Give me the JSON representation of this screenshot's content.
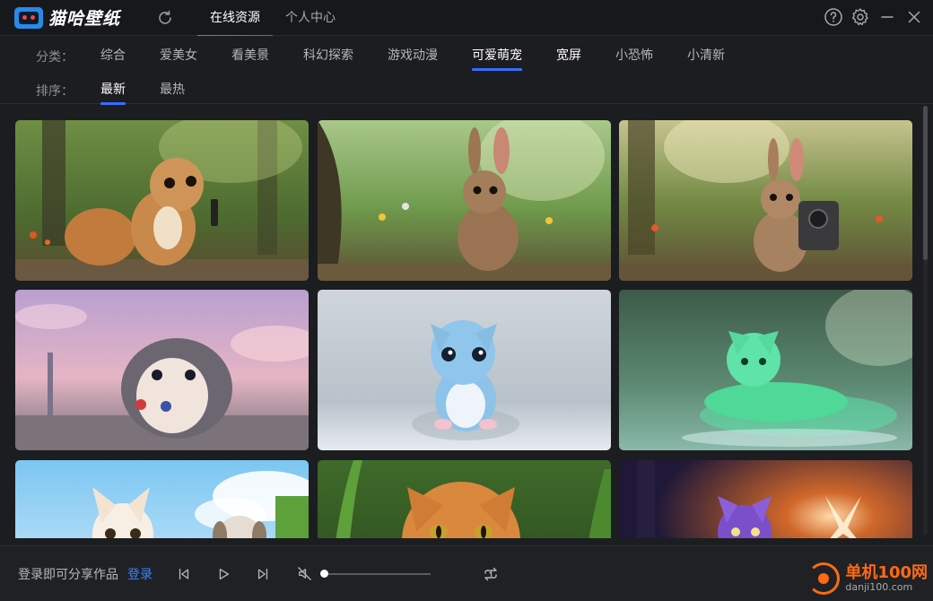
{
  "app": {
    "title": "猫哈壁纸",
    "brand_color": "#2a89e8"
  },
  "header": {
    "tabs": [
      {
        "label": "在线资源",
        "active": true
      },
      {
        "label": "个人中心",
        "active": false
      }
    ],
    "icons": [
      "refresh-icon",
      "help-icon",
      "gear-icon",
      "minimize-icon",
      "close-icon"
    ]
  },
  "filters": {
    "category_label": "分类：",
    "categories": [
      {
        "label": "综合"
      },
      {
        "label": "爱美女"
      },
      {
        "label": "看美景"
      },
      {
        "label": "科幻探索"
      },
      {
        "label": "游戏动漫"
      },
      {
        "label": "可爱萌宠",
        "active": true
      },
      {
        "label": "宽屏"
      },
      {
        "label": "小恐怖"
      },
      {
        "label": "小清新"
      }
    ],
    "sort_label": "排序：",
    "sorts": [
      {
        "label": "最新",
        "active": true
      },
      {
        "label": "最热"
      }
    ],
    "accent": "#3a6cff"
  },
  "gallery": {
    "items": [
      {
        "subject": "chipmunk-in-forest"
      },
      {
        "subject": "rabbit-in-meadow"
      },
      {
        "subject": "rabbit-with-camera"
      },
      {
        "subject": "hedgehog-at-sunset"
      },
      {
        "subject": "blue-fluffy-kitten"
      },
      {
        "subject": "green-glowing-cat"
      },
      {
        "subject": "white-kitten-and-puppy"
      },
      {
        "subject": "orange-tabby-cat"
      },
      {
        "subject": "purple-fantasy-creature"
      }
    ]
  },
  "footer": {
    "share_text": "登录即可分享作品",
    "login_label": "登录",
    "login_color": "#3d82ff",
    "volume": 0.0,
    "icons": [
      "prev-icon",
      "play-icon",
      "next-icon",
      "mute-icon",
      "loop-icon"
    ]
  },
  "watermark": {
    "name": "单机100网",
    "url": "danji100.com",
    "color": "#ff6a13"
  }
}
